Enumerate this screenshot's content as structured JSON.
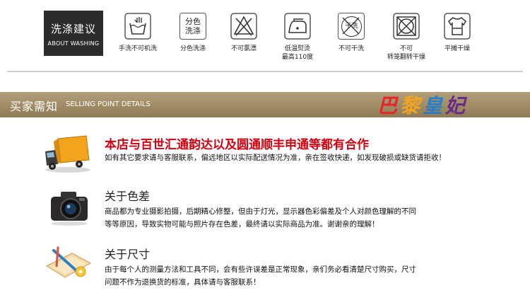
{
  "washing": {
    "title_zh": "洗涤建议",
    "title_en": "ABOUT WASHING",
    "items": [
      {
        "icon": "hand-wash-icon",
        "label": "手洗不可机洗"
      },
      {
        "icon": "separate-wash-icon",
        "badge": "分色\n洗涤",
        "label": "分色洗涤"
      },
      {
        "icon": "no-bleach-icon",
        "label": "不可氯漂"
      },
      {
        "icon": "low-temp-iron-icon",
        "label": "低温熨烫\n最高110度"
      },
      {
        "icon": "no-dry-clean-icon",
        "badge": "干洗",
        "label": "不可干洗"
      },
      {
        "icon": "no-tumble-dry-icon",
        "label": "不可\n转笼翻转干燥"
      },
      {
        "icon": "flat-dry-icon",
        "label": "平摊干燥"
      }
    ]
  },
  "notice": {
    "title_zh": "买家需知",
    "title_en": "SELLING POINT DETAILS",
    "brand": [
      "巴",
      "黎",
      "皇",
      "妃"
    ],
    "brand_colors": [
      "#e8232a",
      "#f4a51c",
      "#2a7cc7",
      "#6a2a8a"
    ]
  },
  "sections": [
    {
      "icon": "delivery-truck-icon",
      "title": "本店与百世汇通韵达以及圆通顺丰申通等都有合作",
      "text": [
        "如有其它要求请与客服联系，偏远地区以实际配送情况为准，亲在签收快递，如发现破损或缺货请拒收！"
      ]
    },
    {
      "icon": "camera-icon",
      "title": "关于色差",
      "text": [
        "商品都为专业摄影拍摄，后期精心修整，但由于灯光，显示器色彩偏差及个人对颜色理解的不同",
        "等等原因，导致实物可能与照片存在色差，最终请以实际商品为准。谢谢亲的理解！"
      ]
    },
    {
      "icon": "measuring-tools-icon",
      "title": "关于尺寸",
      "text": [
        "由于每个人的测量方法和工具不同，会有些许误差是正常现象，亲们务必看清楚尺寸购买，尺寸",
        "问题不作为退换货的标准，具体请与客服联系！"
      ]
    }
  ]
}
